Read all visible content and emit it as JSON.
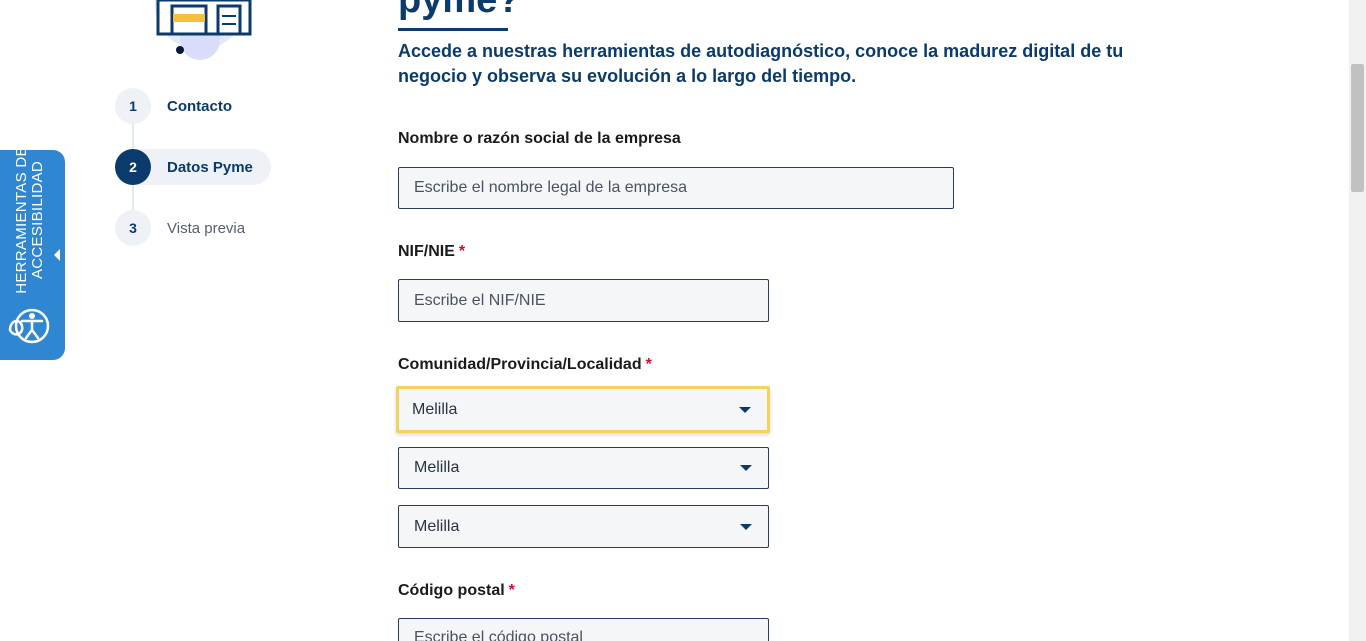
{
  "illustration": {
    "name": "shop-illustration"
  },
  "steps": [
    {
      "number": "1",
      "label": "Contacto",
      "state": "done"
    },
    {
      "number": "2",
      "label": "Datos Pyme",
      "state": "active"
    },
    {
      "number": "3",
      "label": "Vista previa",
      "state": "pending"
    }
  ],
  "accessibility": {
    "line1": "HERRAMIENTAS DE",
    "line2": "ACCESIBILIDAD",
    "icon": "accessibility-icon",
    "arrow_icon": "triangle-left-icon"
  },
  "header": {
    "title": "pyme?",
    "intro": "Accede a nuestras herramientas de autodiagnóstico, conoce la madurez digital de tu negocio y observa su evolución a lo largo del tiempo."
  },
  "form": {
    "company_name": {
      "label": "Nombre o razón social de la empresa",
      "placeholder": "Escribe el nombre legal de la empresa"
    },
    "nif": {
      "label": "NIF/NIE",
      "required_mark": "*",
      "placeholder": "Escribe el NIF/NIE"
    },
    "location": {
      "label": "Comunidad/Provincia/Localidad",
      "required_mark": "*",
      "community": "Melilla",
      "province": "Melilla",
      "locality": "Melilla"
    },
    "postal_code": {
      "label": "Código postal",
      "required_mark": "*",
      "placeholder": "Escribe el código postal"
    }
  },
  "colors": {
    "primary": "#0b3a6d",
    "accent_blue": "#2f86d1",
    "focus": "#f1d35e",
    "required": "#c8102e"
  }
}
